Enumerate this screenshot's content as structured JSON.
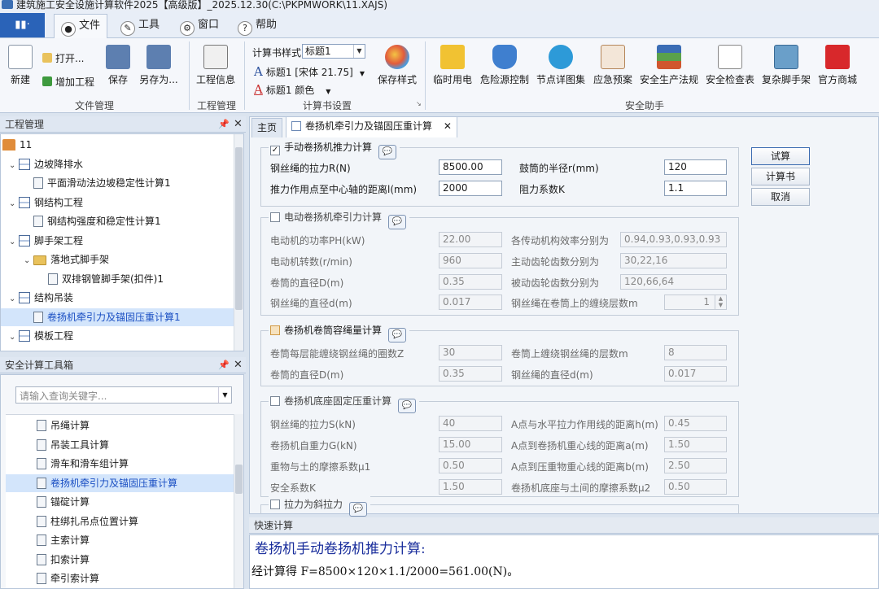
{
  "window": {
    "title": "建筑施工安全设施计算软件2025【高级版】_2025.12.30(C:\\PKPMWORK\\11.XAJS)"
  },
  "menu": {
    "app_button": "▮▮·",
    "tabs": [
      {
        "label": "文件",
        "icon": "file-tab-icon"
      },
      {
        "label": "工具",
        "icon": "wrench-icon"
      },
      {
        "label": "窗口",
        "icon": "gear-icon"
      },
      {
        "label": "帮助",
        "icon": "help-icon"
      }
    ]
  },
  "ribbon": {
    "file_group": {
      "label": "文件管理",
      "new": "新建",
      "open": "打开...",
      "add_project": "增加工程",
      "save": "保存",
      "save_as": "另存为..."
    },
    "project_group": {
      "label": "工程管理",
      "project_info": "工程信息"
    },
    "book_group": {
      "label": "计算书设置",
      "style_label": "计算书样式",
      "style_value": "标题1",
      "font_row": "标题1 [宋体 21.75]",
      "color_row": "标题1 颜色",
      "save_style": "保存样式"
    },
    "safety_group": {
      "label": "安全助手",
      "items": [
        "临时用电",
        "危险源控制",
        "节点详图集",
        "应急预案",
        "安全生产法规",
        "安全检查表",
        "复杂脚手架",
        "官方商城"
      ]
    }
  },
  "project_pane": {
    "title": "工程管理",
    "tree": [
      {
        "label": "11",
        "level": 0,
        "icon": "home"
      },
      {
        "label": "边坡降排水",
        "level": 1,
        "icon": "grid",
        "expanded": true
      },
      {
        "label": "平面滑动法边坡稳定性计算1",
        "level": 2,
        "icon": "doc"
      },
      {
        "label": "钢结构工程",
        "level": 1,
        "icon": "grid",
        "expanded": true
      },
      {
        "label": "钢结构强度和稳定性计算1",
        "level": 2,
        "icon": "doc"
      },
      {
        "label": "脚手架工程",
        "level": 1,
        "icon": "grid",
        "expanded": true
      },
      {
        "label": "落地式脚手架",
        "level": 2,
        "icon": "folder",
        "expanded": true
      },
      {
        "label": "双排钢管脚手架(扣件)1",
        "level": 3,
        "icon": "doc"
      },
      {
        "label": "结构吊装",
        "level": 1,
        "icon": "grid",
        "expanded": true
      },
      {
        "label": "卷扬机牵引力及锚固压重计算1",
        "level": 2,
        "icon": "doc",
        "selected": true
      },
      {
        "label": "模板工程",
        "level": 1,
        "icon": "grid",
        "expanded": true
      }
    ]
  },
  "toolbox_pane": {
    "title": "安全计算工具箱",
    "search_placeholder": "请输入查询关键字...",
    "items": [
      {
        "label": "吊绳计算"
      },
      {
        "label": "吊装工具计算"
      },
      {
        "label": "滑车和滑车组计算"
      },
      {
        "label": "卷扬机牵引力及锚固压重计算",
        "selected": true
      },
      {
        "label": "锚碇计算"
      },
      {
        "label": "柱绑扎吊点位置计算"
      },
      {
        "label": "主索计算"
      },
      {
        "label": "扣索计算"
      },
      {
        "label": "牵引索计算"
      }
    ]
  },
  "main": {
    "tabs": [
      {
        "label": "主页"
      },
      {
        "label": "卷扬机牵引力及锚固压重计算",
        "active": true
      }
    ],
    "buttons": {
      "calculate": "试算",
      "report": "计算书",
      "cancel": "取消"
    },
    "group1": {
      "title": "手动卷扬机推力计算",
      "checked": true,
      "fields": [
        {
          "label": "钢丝绳的拉力R(N)",
          "value": "8500.00"
        },
        {
          "label": "鼓筒的半径r(mm)",
          "value": "120"
        },
        {
          "label": "推力作用点至中心轴的距离l(mm)",
          "value": "2000"
        },
        {
          "label": "阻力系数K",
          "value": "1.1"
        }
      ]
    },
    "group2": {
      "title": "电动卷扬机牵引力计算",
      "checked": false,
      "fields": [
        {
          "label": "电动机的功率PH(kW)",
          "value": "22.00"
        },
        {
          "label": "各传动机构效率分别为",
          "value": "0.94,0.93,0.93,0.93"
        },
        {
          "label": "电动机转数(r/min)",
          "value": "960"
        },
        {
          "label": "主动齿轮齿数分别为",
          "value": "30,22,16"
        },
        {
          "label": "卷筒的直径D(m)",
          "value": "0.35"
        },
        {
          "label": "被动齿轮齿数分别为",
          "value": "120,66,64"
        },
        {
          "label": "钢丝绳的直径d(m)",
          "value": "0.017"
        },
        {
          "label": "钢丝绳在卷筒上的缠绕层数m",
          "value": "1"
        }
      ]
    },
    "group3": {
      "title": "卷扬机卷筒容绳量计算",
      "checked": false,
      "fields": [
        {
          "label": "卷筒每层能缠绕钢丝绳的圈数Z",
          "value": "30"
        },
        {
          "label": "卷筒上缠绕钢丝绳的层数m",
          "value": "8"
        },
        {
          "label": "卷筒的直径D(m)",
          "value": "0.35"
        },
        {
          "label": "钢丝绳的直径d(m)",
          "value": "0.017"
        }
      ]
    },
    "group4": {
      "title": "卷扬机底座固定压重计算",
      "checked": false,
      "fields": [
        {
          "label": "钢丝绳的拉力S(kN)",
          "value": "40"
        },
        {
          "label": "A点与水平拉力作用线的距离h(m)",
          "value": "0.45"
        },
        {
          "label": "卷扬机自重力G(kN)",
          "value": "15.00"
        },
        {
          "label": "A点到卷扬机重心线的距离a(m)",
          "value": "1.50"
        },
        {
          "label": "重物与土的摩擦系数μ1",
          "value": "0.50"
        },
        {
          "label": "A点到压重物重心线的距离b(m)",
          "value": "2.50"
        },
        {
          "label": "安全系数K",
          "value": "1.50"
        },
        {
          "label": "卷扬机底座与土间的摩擦系数μ2",
          "value": "0.50"
        }
      ]
    },
    "group5": {
      "title": "拉力为斜拉力",
      "checked": false
    }
  },
  "quick_calc": {
    "title": "快速计算",
    "heading": "卷扬机手动卷扬机推力计算:",
    "result": "经计算得  F=8500×120×1.1/2000=561.00(N)。"
  },
  "colors": {
    "accent": "#2a63b8",
    "selection": "#d3e5fb",
    "panel_bg": "#dbe4ef"
  }
}
